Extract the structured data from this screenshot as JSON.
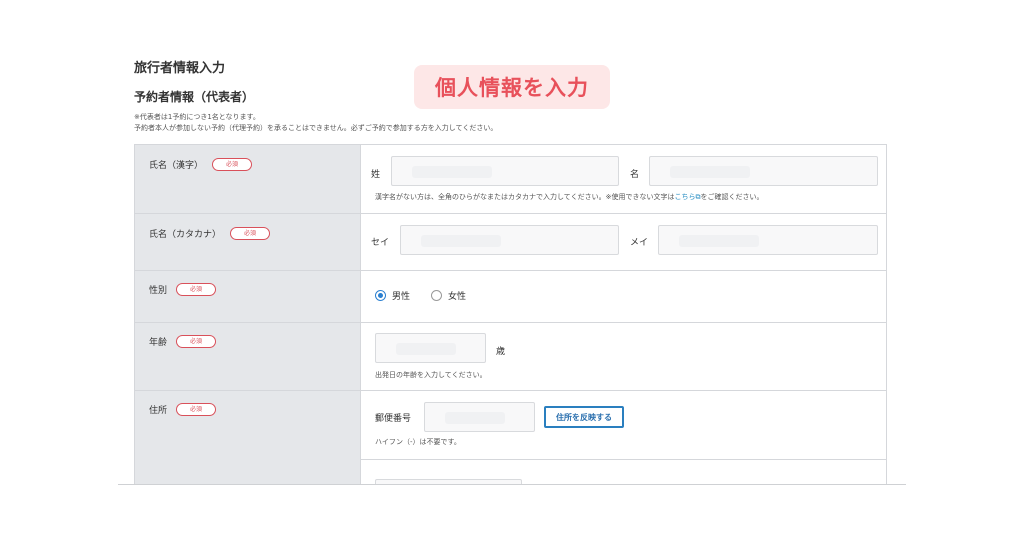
{
  "page": {
    "title": "旅行者情報入力",
    "section_title": "予約者情報（代表者）",
    "notes": [
      "※代表者は1予約につき1名となります。",
      "予約者本人が参加しない予約（代理予約）を承ることはできません。必ずご予約で参加する方を入力してください。"
    ]
  },
  "overlay": {
    "text": "個人情報を入力",
    "color": "#e8515b",
    "background": "#fde7e7"
  },
  "required_label": "必須",
  "form": {
    "name_kanji": {
      "label": "氏名（漢字）",
      "sei_label": "姓",
      "mei_label": "名",
      "help_before": "漢字名がない方は、全角のひらがなまたはカタカナで入力してください。※使用できない文字は",
      "help_link": "こちら",
      "help_after": "をご確認ください。"
    },
    "name_kana": {
      "label": "氏名（カタカナ）",
      "sei_label": "セイ",
      "mei_label": "メイ"
    },
    "gender": {
      "label": "性別",
      "options": [
        "男性",
        "女性"
      ],
      "selected": "男性"
    },
    "age": {
      "label": "年齢",
      "unit": "歳",
      "help": "出発日の年齢を入力してください。"
    },
    "address": {
      "label": "住所",
      "postal_label": "郵便番号",
      "reflect_button": "住所を反映する",
      "help": "ハイフン（-）は不要です。"
    }
  },
  "colors": {
    "accent_blue": "#2a7fd0",
    "required_red": "#d9505a",
    "label_column_bg": "#e5e7ea"
  }
}
